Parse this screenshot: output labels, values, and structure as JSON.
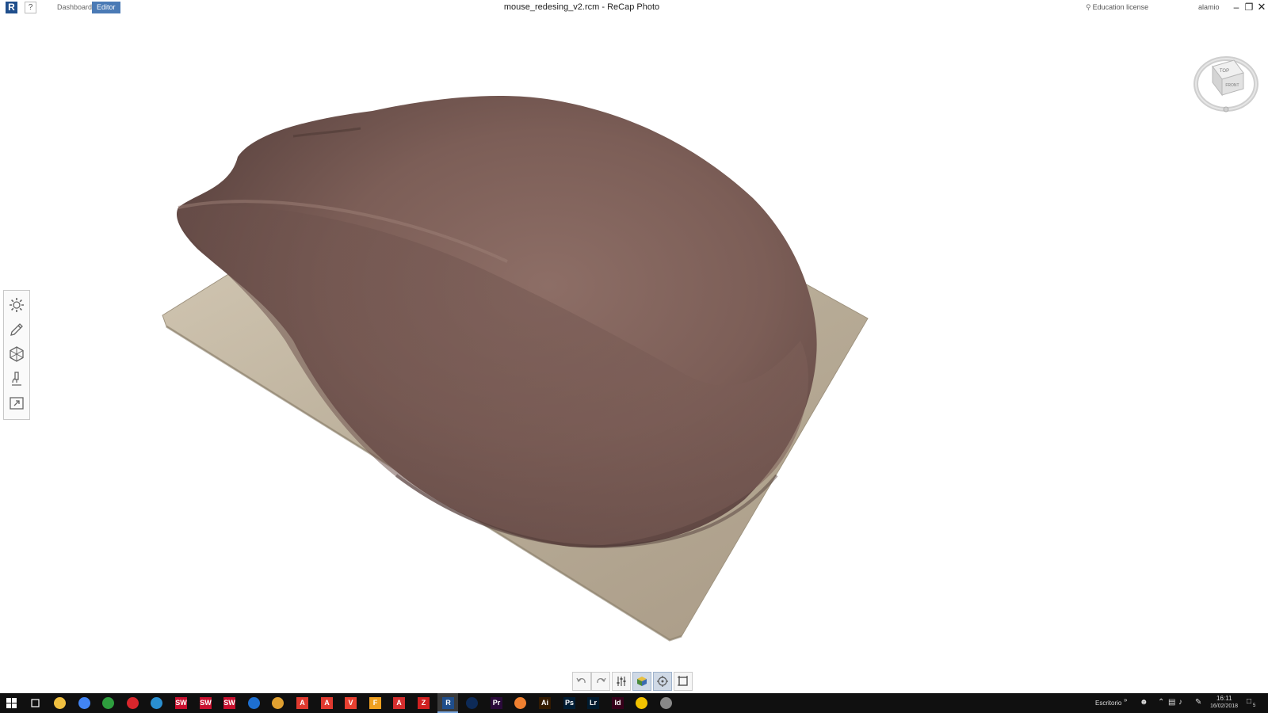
{
  "app": {
    "logo_letter": "R",
    "help_label": "?",
    "tabs": [
      {
        "label": "Dashboard",
        "active": false
      },
      {
        "label": "Editor",
        "active": true
      }
    ],
    "window_title": "mouse_redesing_v2.rcm - ReCap Photo",
    "license_label": "Education license",
    "user_name": "alamio",
    "window_controls": {
      "minimize": "–",
      "maximize": "❐",
      "close": "✕"
    }
  },
  "viewcube": {
    "top_label": "TOP",
    "front_label": "FRONT"
  },
  "left_toolbar": [
    {
      "name": "settings-tool",
      "icon": "gear-icon"
    },
    {
      "name": "edit-tool",
      "icon": "pencil-icon"
    },
    {
      "name": "mesh-tool",
      "icon": "hexagon-mesh-icon"
    },
    {
      "name": "measure-tool",
      "icon": "microscope-icon"
    },
    {
      "name": "export-tool",
      "icon": "export-arrow-icon"
    }
  ],
  "bottom_toolbar": [
    {
      "name": "undo-button",
      "icon": "undo-icon",
      "active": false
    },
    {
      "name": "redo-button",
      "icon": "redo-icon",
      "active": false
    },
    {
      "name": "settings-sliders-button",
      "icon": "sliders-icon",
      "active": false
    },
    {
      "name": "render-mode-button",
      "icon": "cube-icon",
      "active": true
    },
    {
      "name": "orbit-button",
      "icon": "orbit-icon",
      "active": true
    },
    {
      "name": "fit-view-button",
      "icon": "frame-icon",
      "active": false
    }
  ],
  "taskbar": {
    "apps": [
      {
        "name": "file-explorer",
        "label": "",
        "color": "#f0c040"
      },
      {
        "name": "chrome",
        "label": "",
        "color": "#4285f4"
      },
      {
        "name": "green-app",
        "label": "",
        "color": "#2e9e3e"
      },
      {
        "name": "red-app",
        "label": "",
        "color": "#d9262c"
      },
      {
        "name": "cube-app",
        "label": "",
        "color": "#2a8fd0"
      },
      {
        "name": "solidworks-1",
        "label": "SW",
        "color": "#c8102e"
      },
      {
        "name": "solidworks-2",
        "label": "SW",
        "color": "#c8102e"
      },
      {
        "name": "solidworks-3",
        "label": "SW",
        "color": "#c8102e"
      },
      {
        "name": "blue-circle-app",
        "label": "",
        "color": "#1e6fd0"
      },
      {
        "name": "shield-app",
        "label": "",
        "color": "#e0a030"
      },
      {
        "name": "acrobat-1",
        "label": "A",
        "color": "#e03a2f"
      },
      {
        "name": "acrobat-2",
        "label": "A",
        "color": "#e03a2f"
      },
      {
        "name": "v-app",
        "label": "V",
        "color": "#e84030"
      },
      {
        "name": "f-app",
        "label": "F",
        "color": "#f0a020"
      },
      {
        "name": "autocad",
        "label": "A",
        "color": "#d42e2e"
      },
      {
        "name": "z-app",
        "label": "Z",
        "color": "#d02020"
      },
      {
        "name": "recap",
        "label": "R",
        "color": "#1f4e8c"
      },
      {
        "name": "cinema4d",
        "label": "",
        "color": "#0d2a57"
      },
      {
        "name": "premiere",
        "label": "Pr",
        "color": "#2a0a3a"
      },
      {
        "name": "pen-app",
        "label": "",
        "color": "#f08030"
      },
      {
        "name": "illustrator",
        "label": "Ai",
        "color": "#331a00"
      },
      {
        "name": "photoshop",
        "label": "Ps",
        "color": "#001d34"
      },
      {
        "name": "lightroom",
        "label": "Lr",
        "color": "#001a2e"
      },
      {
        "name": "indesign",
        "label": "Id",
        "color": "#36001a"
      },
      {
        "name": "a-logo-app",
        "label": "",
        "color": "#f2c200"
      },
      {
        "name": "disk-app",
        "label": "",
        "color": "#888888"
      }
    ],
    "active_app": "recap",
    "desktop_label": "Escritorio",
    "desktop_chevron": "»",
    "time": "16:11",
    "date": "16/02/2018",
    "notification_count": "5"
  }
}
